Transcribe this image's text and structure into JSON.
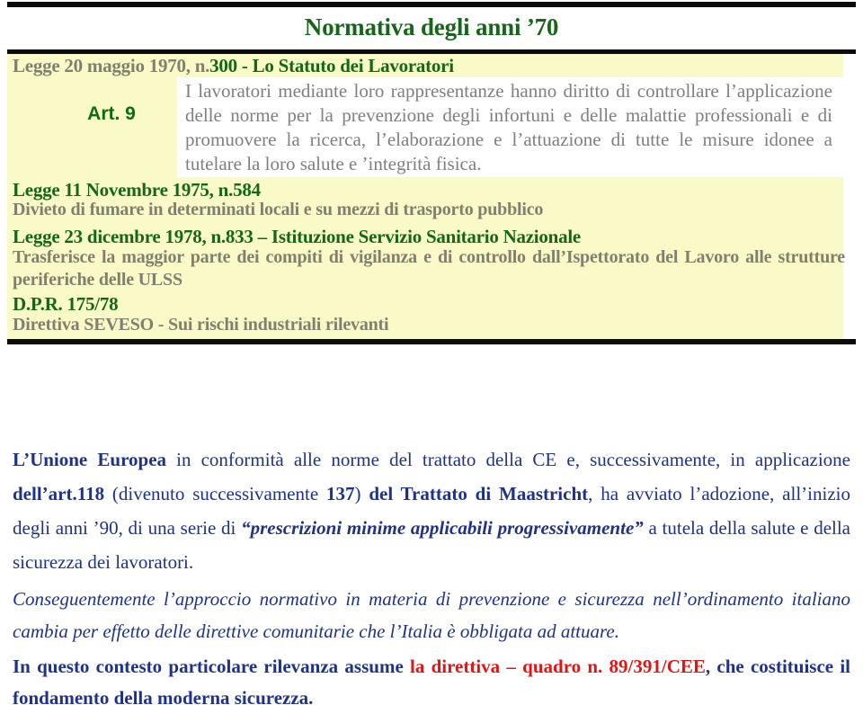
{
  "slide": {
    "title": "Normativa degli anni ’70",
    "colors": {
      "title_green": "#17651b",
      "panel_yellow": "#fafac9",
      "muted_olive": "#80806e",
      "quote_grey": "#7f7f7f",
      "body_navy": "#1f3287",
      "accent_red": "#e31414",
      "rule_black": "#0b0b0b"
    }
  },
  "panel": {
    "law_300": {
      "heading_prefix": "Legge 20 maggio 1970, n.",
      "heading_suffix": "300 - Lo Statuto dei Lavoratori",
      "article_label": "Art. 9",
      "quote_line_1": "I lavoratori mediante loro rappresentanze hanno diritto di controllare",
      "quote_line_2": "l’applicazione delle norme per la prevenzione degli infortuni e delle malattie",
      "quote_line_3": "professionali e di promuovere la ricerca, l’elaborazione e l’attuazione di tutte le",
      "quote_line_4": "misure idonee a tutelare la loro salute e ’integrità fisica."
    },
    "law_584": {
      "heading_prefix": "Legge 11 Novembre 1975, n.",
      "heading_suffix": "584",
      "subtitle": "Divieto di fumare in determinati locali e su mezzi di trasporto pubblico"
    },
    "law_833": {
      "heading": "Legge 23 dicembre 1978, n.833 – Istituzione Servizio Sanitario Nazionale",
      "subtitle_line_1": "Trasferisce la maggior parte dei compiti di vigilanza e di controllo dall’Ispettorato del",
      "subtitle_line_2": "Lavoro alle strutture periferiche delle ULSS"
    },
    "dpr_175": {
      "heading": "D.P.R. 175/78",
      "subtitle": "Direttiva SEVESO -  Sui rischi industriali rilevanti"
    }
  },
  "body": {
    "paragraph_1": {
      "seg_1_bold": "L’Unione Europea",
      "seg_2": " in conformità alle norme del trattato della CE e, successivamente, in applicazione ",
      "seg_3_bold": "dell’art.118",
      "seg_4": " (divenuto successivamente ",
      "seg_5_bold": "137",
      "seg_6": ") ",
      "seg_7_bold": "del Trattato di Maastricht",
      "seg_8": ", ha avviato l’adozione, all’inizio degli anni ’90, di una serie di ",
      "seg_9_bolditalic": "“prescrizioni minime applicabili progressivamente”",
      "seg_10": " a tutela della salute e della sicurezza dei lavoratori."
    },
    "paragraph_2": {
      "text": "Conseguentemente l’approccio normativo in materia di prevenzione e sicurezza nell’ordinamento italiano cambia per effetto delle direttive comunitarie che l’Italia è obbligata ad attuare."
    },
    "paragraph_3": {
      "seg_1": "In questo contesto particolare rilevanza assume ",
      "seg_2_red": "la direttiva – quadro n. 89/391/CEE",
      "seg_3": ", che costituisce il fondamento della moderna sicurezza."
    }
  }
}
